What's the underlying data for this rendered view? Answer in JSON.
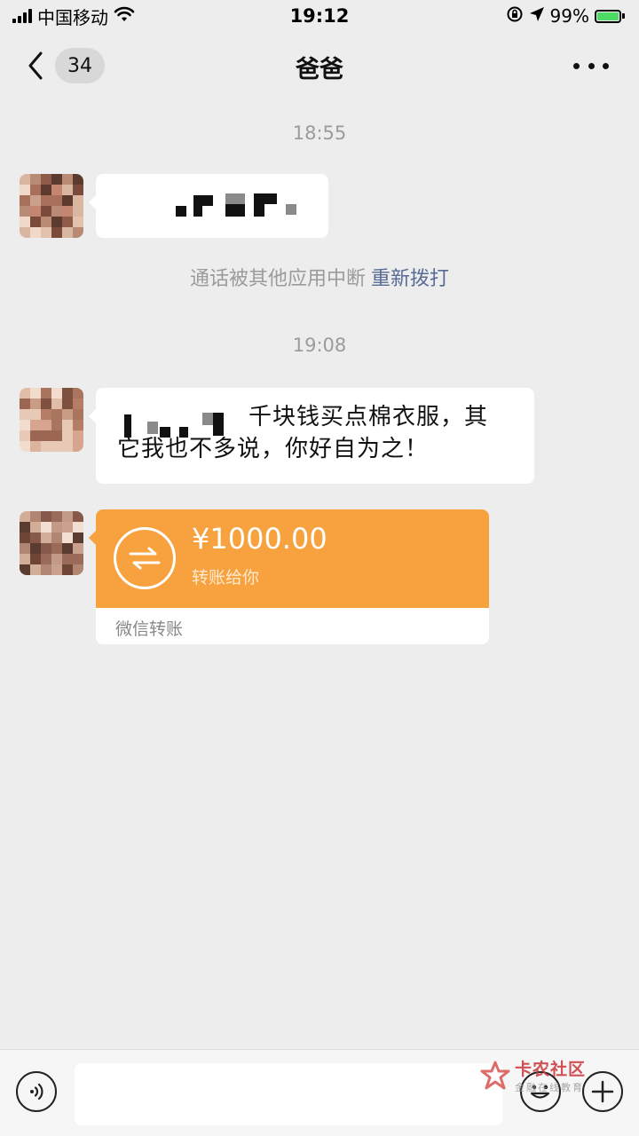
{
  "status_bar": {
    "carrier": "中国移动",
    "time": "19:12",
    "battery": "99%"
  },
  "nav": {
    "unread_count": "34",
    "title": "爸爸"
  },
  "messages": {
    "time_1": "18:55",
    "call_status": "通话被其他应用中断",
    "redial": "重新拨打",
    "time_2": "19:08",
    "text_line_1": "千块钱买点棉衣服，其",
    "text_line_2": "它我也不多说，你好自为之！",
    "transfer": {
      "amount": "¥1000.00",
      "description": "转账给你",
      "footer": "微信转账"
    }
  },
  "input": {
    "placeholder": ""
  },
  "watermark": {
    "main": "卡农社区",
    "sub": "金融在线教育"
  },
  "colors": {
    "background": "#ededed",
    "transfer_orange": "#f7a23e",
    "link_blue": "#576b95",
    "battery_green": "#4cd964"
  }
}
